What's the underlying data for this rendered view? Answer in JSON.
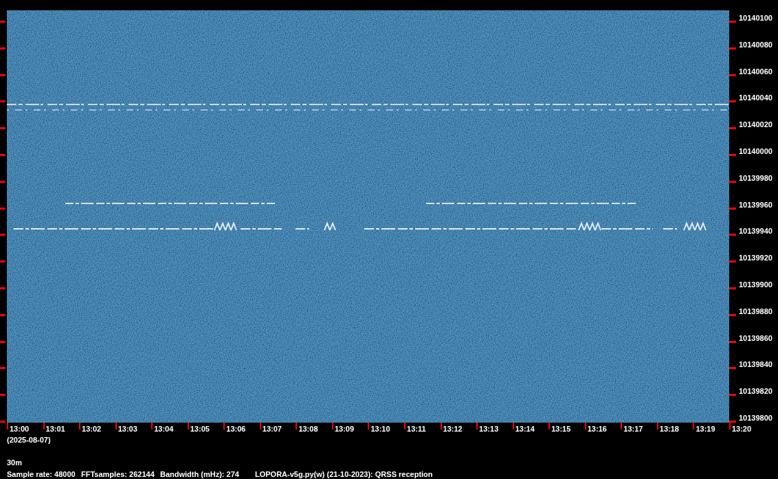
{
  "waterfall": {
    "frequency_labels": [
      "10140100",
      "10140080",
      "10140060",
      "10140040",
      "10140020",
      "10140000",
      "10139980",
      "10139960",
      "10139940",
      "10139920",
      "10139900",
      "10139880",
      "10139860",
      "10139840",
      "10139820",
      "10139800"
    ],
    "time_labels": [
      "13:00",
      "13:01",
      "13:02",
      "13:03",
      "13:04",
      "13:05",
      "13:06",
      "13:07",
      "13:08",
      "13:09",
      "13:10",
      "13:11",
      "13:12",
      "13:13",
      "13:14",
      "13:15",
      "13:16",
      "13:17",
      "13:18",
      "13:19",
      "13:20"
    ],
    "date": "(2025-08-07)"
  },
  "band": "30m",
  "info": [
    "Sample rate: 48000",
    "FFTsamples: 262144",
    "Bandwidth (mHz): 274",
    "LOPORA-v5g.py(w) (21-10-2023): QRSS reception"
  ]
}
